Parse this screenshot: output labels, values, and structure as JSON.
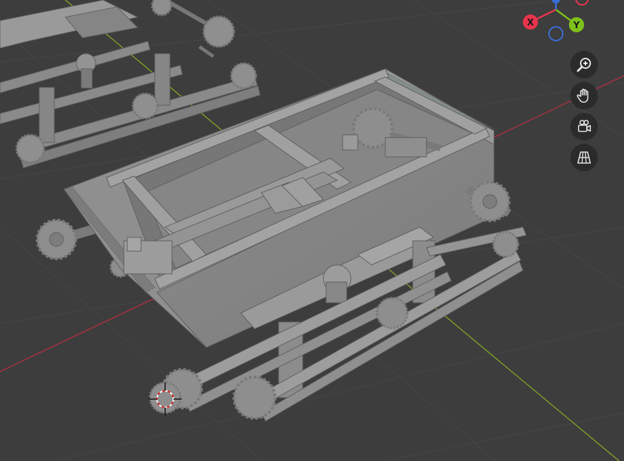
{
  "viewport": {
    "background": "#3d3d3d",
    "grid_color": "#454545",
    "model_color": "#8c8c8c",
    "x_axis_color": "#b03040",
    "y_axis_color": "#7fa326"
  },
  "gizmo": {
    "x": {
      "label": "X",
      "color": "#e8344d"
    },
    "y": {
      "label": "Y",
      "color": "#7fc11a"
    },
    "z": {
      "label": "",
      "color": "#3a6fdb"
    },
    "neg_x_color": "#e8344d",
    "neg_z_color": "#3a6fdb"
  },
  "navigation": [
    {
      "icon": "zoom-icon"
    },
    {
      "icon": "hand-pan-icon"
    },
    {
      "icon": "camera-icon"
    },
    {
      "icon": "grid-perspective-icon"
    }
  ]
}
